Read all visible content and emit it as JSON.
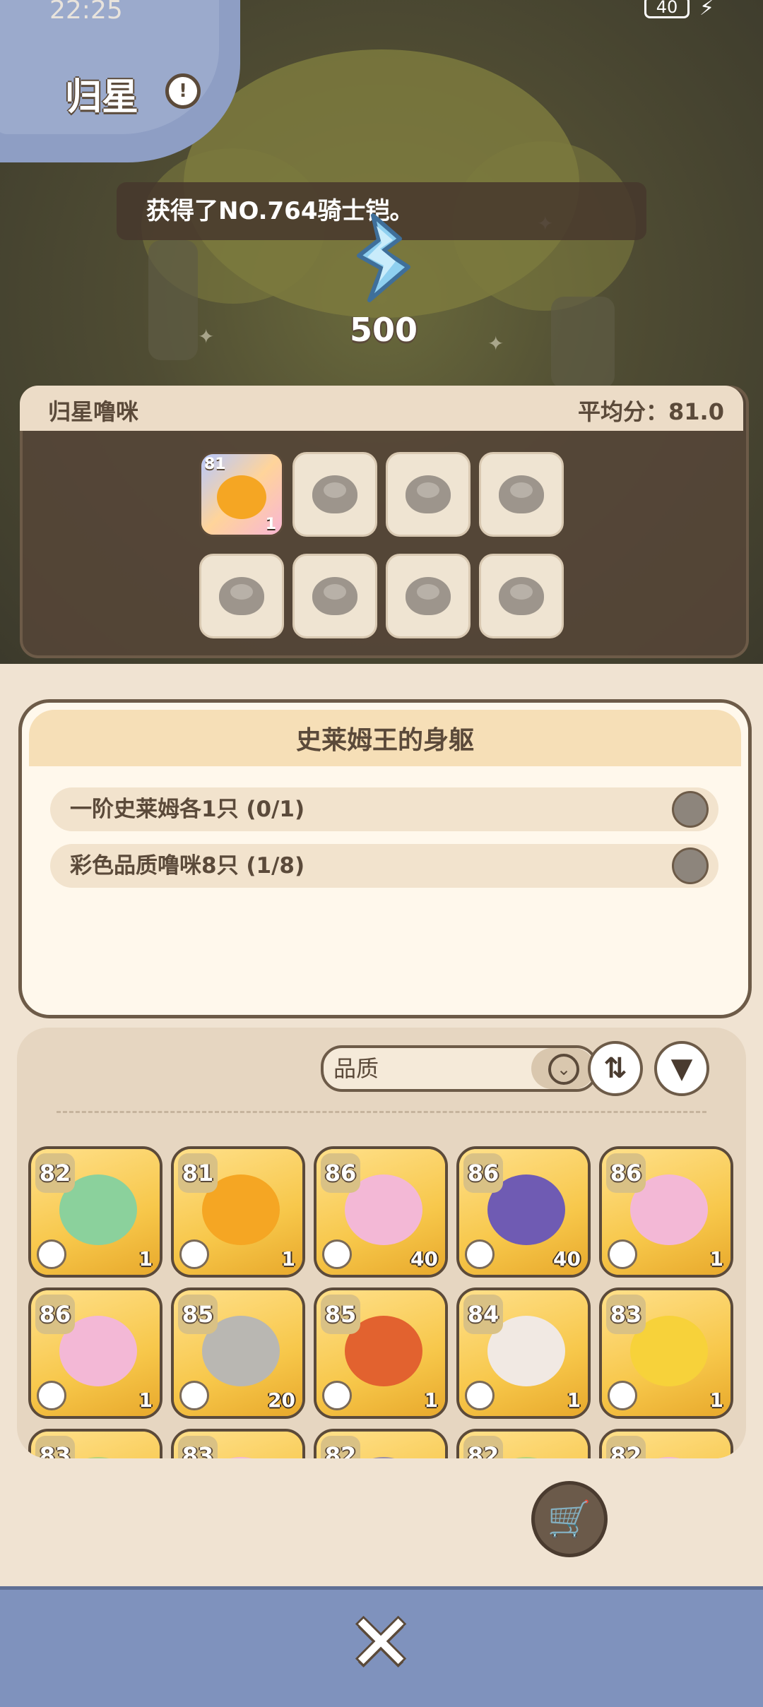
{
  "status_bar": {
    "time": "22:25",
    "battery": "40"
  },
  "header": {
    "title": "归星"
  },
  "toast": {
    "text": "获得了NO.764骑士铠。"
  },
  "energy": {
    "value": "500"
  },
  "team": {
    "name": "归星噜咪",
    "average": "平均分：81.0",
    "slots": [
      {
        "level": "81",
        "count": "1",
        "filled": true
      }
    ]
  },
  "mission": {
    "title": "史莱姆王的身躯",
    "requirements": [
      {
        "text": "一阶史莱姆各1只 (0/1)"
      },
      {
        "text": "彩色品质噜咪8只 (1/8)"
      }
    ]
  },
  "roster": {
    "sort_label": "品质",
    "cards": [
      {
        "level": "82",
        "count": "1",
        "color": "#8bd19c"
      },
      {
        "level": "81",
        "count": "1",
        "color": "#f5a623"
      },
      {
        "level": "86",
        "count": "40",
        "color": "#f3b8d6"
      },
      {
        "level": "86",
        "count": "40",
        "color": "#6f5bb3"
      },
      {
        "level": "86",
        "count": "1",
        "color": "#f3b8d6"
      },
      {
        "level": "86",
        "count": "1",
        "color": "#f3b8d6"
      },
      {
        "level": "85",
        "count": "20",
        "color": "#b9b7b2"
      },
      {
        "level": "85",
        "count": "1",
        "color": "#e2622f"
      },
      {
        "level": "84",
        "count": "1",
        "color": "#f1e9e3"
      },
      {
        "level": "83",
        "count": "1",
        "color": "#f7d23a"
      },
      {
        "level": "83",
        "count": "",
        "color": "#b7d37a"
      },
      {
        "level": "83",
        "count": "",
        "color": "#f3b8d6"
      },
      {
        "level": "82",
        "count": "",
        "color": "#9a8fa8"
      },
      {
        "level": "82",
        "count": "",
        "color": "#b7d37a"
      },
      {
        "level": "82",
        "count": "",
        "color": "#f3b8d6"
      }
    ]
  }
}
